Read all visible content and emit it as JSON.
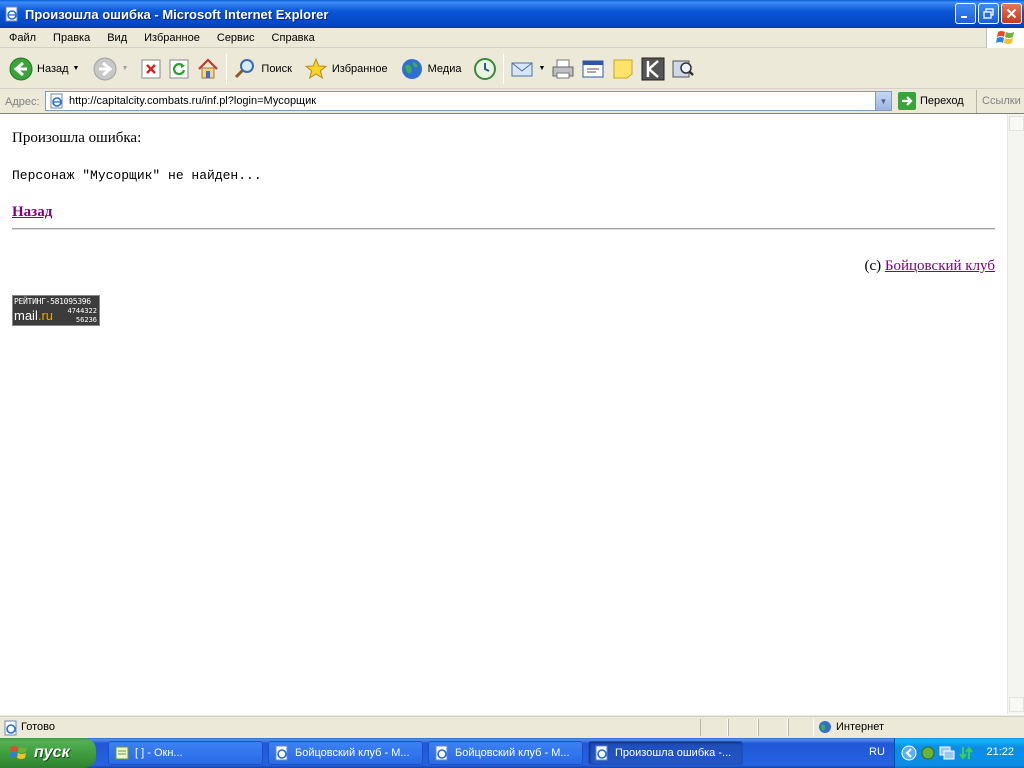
{
  "window": {
    "title": "Произошла ошибка - Microsoft Internet Explorer"
  },
  "menu": [
    "Файл",
    "Правка",
    "Вид",
    "Избранное",
    "Сервис",
    "Справка"
  ],
  "toolbar": {
    "back_label": "Назад",
    "search_label": "Поиск",
    "favorites_label": "Избранное",
    "media_label": "Медиа"
  },
  "address": {
    "label": "Адрес:",
    "url": "http://capitalcity.combats.ru/inf.pl?login=Мусорщик",
    "go_label": "Переход",
    "links_label": "Ссылки"
  },
  "page": {
    "heading": "Произошла ошибка:",
    "message": "Персонаж \"Мусорщик\" не найден...",
    "back_link": "Назад",
    "copyright_prefix": "(c) ",
    "copyright_link": "Бойцовский клуб",
    "counter": {
      "line1": "РЕЙТИНГ-581095396",
      "brand_a": "mail",
      "brand_b": ".ru",
      "line2": "4744322",
      "line3": "56236"
    }
  },
  "status": {
    "text": "Готово",
    "zone": "Интернет"
  },
  "taskbar": {
    "start_label": "пуск",
    "tasks": [
      "[          ] - Окн...",
      "Бойцовский клуб - M...",
      "Бойцовский клуб - M...",
      "Произошла ошибка -..."
    ],
    "lang": "RU",
    "clock": "21:22"
  }
}
